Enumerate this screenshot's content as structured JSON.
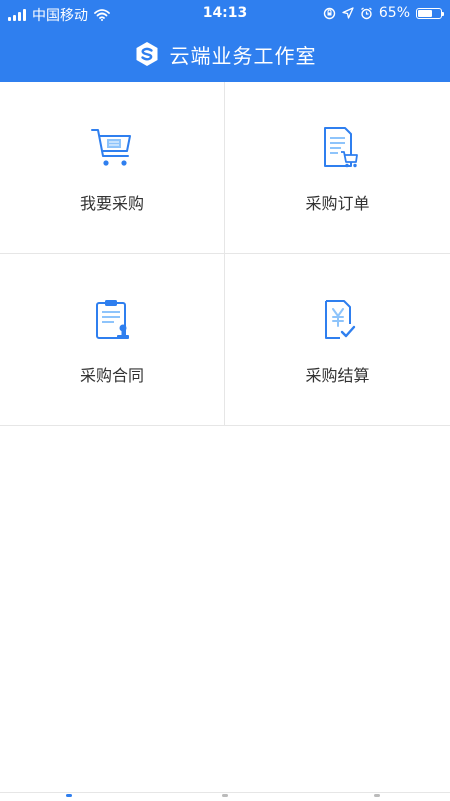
{
  "status_bar": {
    "carrier": "中国移动",
    "time": "14:13",
    "battery": "65%",
    "battery_level": 0.65,
    "icons": [
      "signal-icon",
      "wifi-icon",
      "rotation-lock-icon",
      "location-icon",
      "alarm-icon",
      "battery-icon"
    ]
  },
  "header": {
    "logo_icon": "app-logo-icon",
    "title": "云端业务工作室"
  },
  "menu": [
    {
      "id": "purchase",
      "label": "我要采购",
      "icon": "shopping-cart-icon"
    },
    {
      "id": "orders",
      "label": "采购订单",
      "icon": "order-list-icon"
    },
    {
      "id": "contract",
      "label": "采购合同",
      "icon": "contract-stamp-icon"
    },
    {
      "id": "settlement",
      "label": "采购结算",
      "icon": "settlement-yen-icon"
    }
  ],
  "colors": {
    "primary": "#2f7fef",
    "icon_light": "#8ec4fb",
    "text": "#333333",
    "divider": "#e6e6e6"
  }
}
